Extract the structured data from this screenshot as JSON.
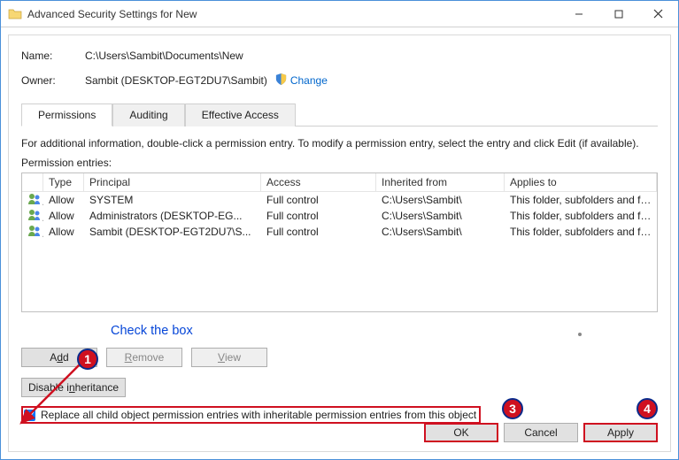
{
  "window": {
    "title": "Advanced Security Settings for New"
  },
  "info": {
    "name_label": "Name:",
    "name_value": "C:\\Users\\Sambit\\Documents\\New",
    "owner_label": "Owner:",
    "owner_value": "Sambit (DESKTOP-EGT2DU7\\Sambit)",
    "change_link": "Change"
  },
  "tabs": {
    "permissions": "Permissions",
    "auditing": "Auditing",
    "effective": "Effective Access"
  },
  "desc": "For additional information, double-click a permission entry. To modify a permission entry, select the entry and click Edit (if available).",
  "entries_label": "Permission entries:",
  "headers": {
    "type": "Type",
    "principal": "Principal",
    "access": "Access",
    "inherited": "Inherited from",
    "applies": "Applies to"
  },
  "rows": [
    {
      "type": "Allow",
      "principal": "SYSTEM",
      "access": "Full control",
      "inherited": "C:\\Users\\Sambit\\",
      "applies": "This folder, subfolders and files"
    },
    {
      "type": "Allow",
      "principal": "Administrators (DESKTOP-EG...",
      "access": "Full control",
      "inherited": "C:\\Users\\Sambit\\",
      "applies": "This folder, subfolders and files"
    },
    {
      "type": "Allow",
      "principal": "Sambit (DESKTOP-EGT2DU7\\S...",
      "access": "Full control",
      "inherited": "C:\\Users\\Sambit\\",
      "applies": "This folder, subfolders and files"
    }
  ],
  "annotation": {
    "text": "Check the box",
    "b1": "1",
    "b3": "3",
    "b4": "4"
  },
  "buttons": {
    "add": "Add",
    "remove": "Remove",
    "view": "View",
    "disable_inh": "Disable inheritance",
    "ok": "OK",
    "cancel": "Cancel",
    "apply": "Apply"
  },
  "checkbox": {
    "label": "Replace all child object permission entries with inheritable permission entries from this object"
  }
}
